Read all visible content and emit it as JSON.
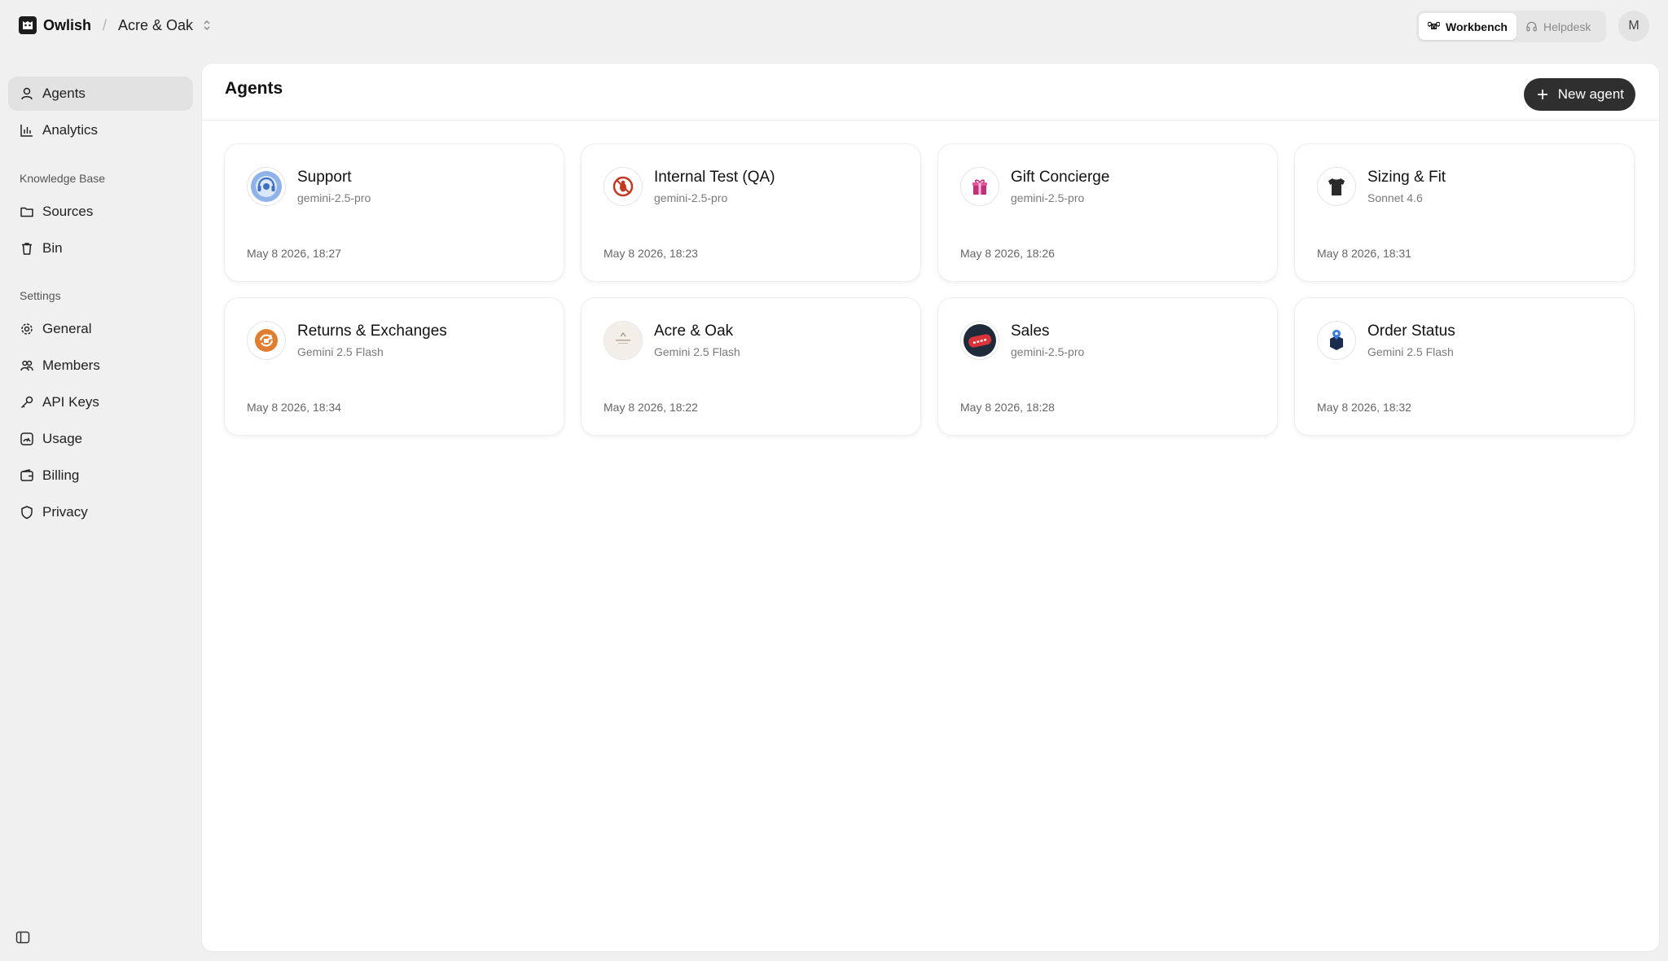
{
  "topbar": {
    "brand": "Owlish",
    "separator": "/",
    "workspace": "Acre & Oak",
    "modes": [
      {
        "label": "Workbench",
        "active": true,
        "icon": "command-icon"
      },
      {
        "label": "Helpdesk",
        "active": false,
        "icon": "headphones-icon"
      }
    ],
    "avatar_initial": "M"
  },
  "sidebar": {
    "primary": [
      {
        "label": "Agents",
        "icon": "agent-icon",
        "active": true
      },
      {
        "label": "Analytics",
        "icon": "bar-chart-icon",
        "active": false
      }
    ],
    "knowledge_base": {
      "title": "Knowledge Base",
      "items": [
        {
          "label": "Sources",
          "icon": "folder-icon"
        },
        {
          "label": "Bin",
          "icon": "trash-icon"
        }
      ]
    },
    "settings": {
      "title": "Settings",
      "items": [
        {
          "label": "General",
          "icon": "gear-icon"
        },
        {
          "label": "Members",
          "icon": "users-icon"
        },
        {
          "label": "API Keys",
          "icon": "key-icon"
        },
        {
          "label": "Usage",
          "icon": "gauge-icon"
        },
        {
          "label": "Billing",
          "icon": "wallet-icon"
        },
        {
          "label": "Privacy",
          "icon": "shield-icon"
        }
      ]
    }
  },
  "main": {
    "title": "Agents",
    "new_agent_label": "New agent",
    "agents": [
      {
        "name": "Support",
        "model": "gemini-2.5-pro",
        "date": "May 8 2026, 18:27",
        "icon": "support-headset-icon"
      },
      {
        "name": "Internal Test (QA)",
        "model": "gemini-2.5-pro",
        "date": "May 8 2026, 18:23",
        "icon": "qa-bug-icon"
      },
      {
        "name": "Gift Concierge",
        "model": "gemini-2.5-pro",
        "date": "May 8 2026, 18:26",
        "icon": "gift-icon"
      },
      {
        "name": "Sizing & Fit",
        "model": "Sonnet 4.6",
        "date": "May 8 2026, 18:31",
        "icon": "tshirt-icon"
      },
      {
        "name": "Returns & Exchanges",
        "model": "Gemini 2.5 Flash",
        "date": "May 8 2026, 18:34",
        "icon": "returns-icon"
      },
      {
        "name": "Acre & Oak",
        "model": "Gemini 2.5 Flash",
        "date": "May 8 2026, 18:22",
        "icon": "brand-logo-icon"
      },
      {
        "name": "Sales",
        "model": "gemini-2.5-pro",
        "date": "May 8 2026, 18:28",
        "icon": "sales-badge-icon"
      },
      {
        "name": "Order Status",
        "model": "Gemini 2.5 Flash",
        "date": "May 8 2026, 18:32",
        "icon": "package-location-icon"
      }
    ]
  },
  "colors": {
    "background": "#f0f0f0",
    "panel": "#ffffff",
    "button_dark": "#2f2f2f",
    "nav_active": "#e2e2e2"
  }
}
